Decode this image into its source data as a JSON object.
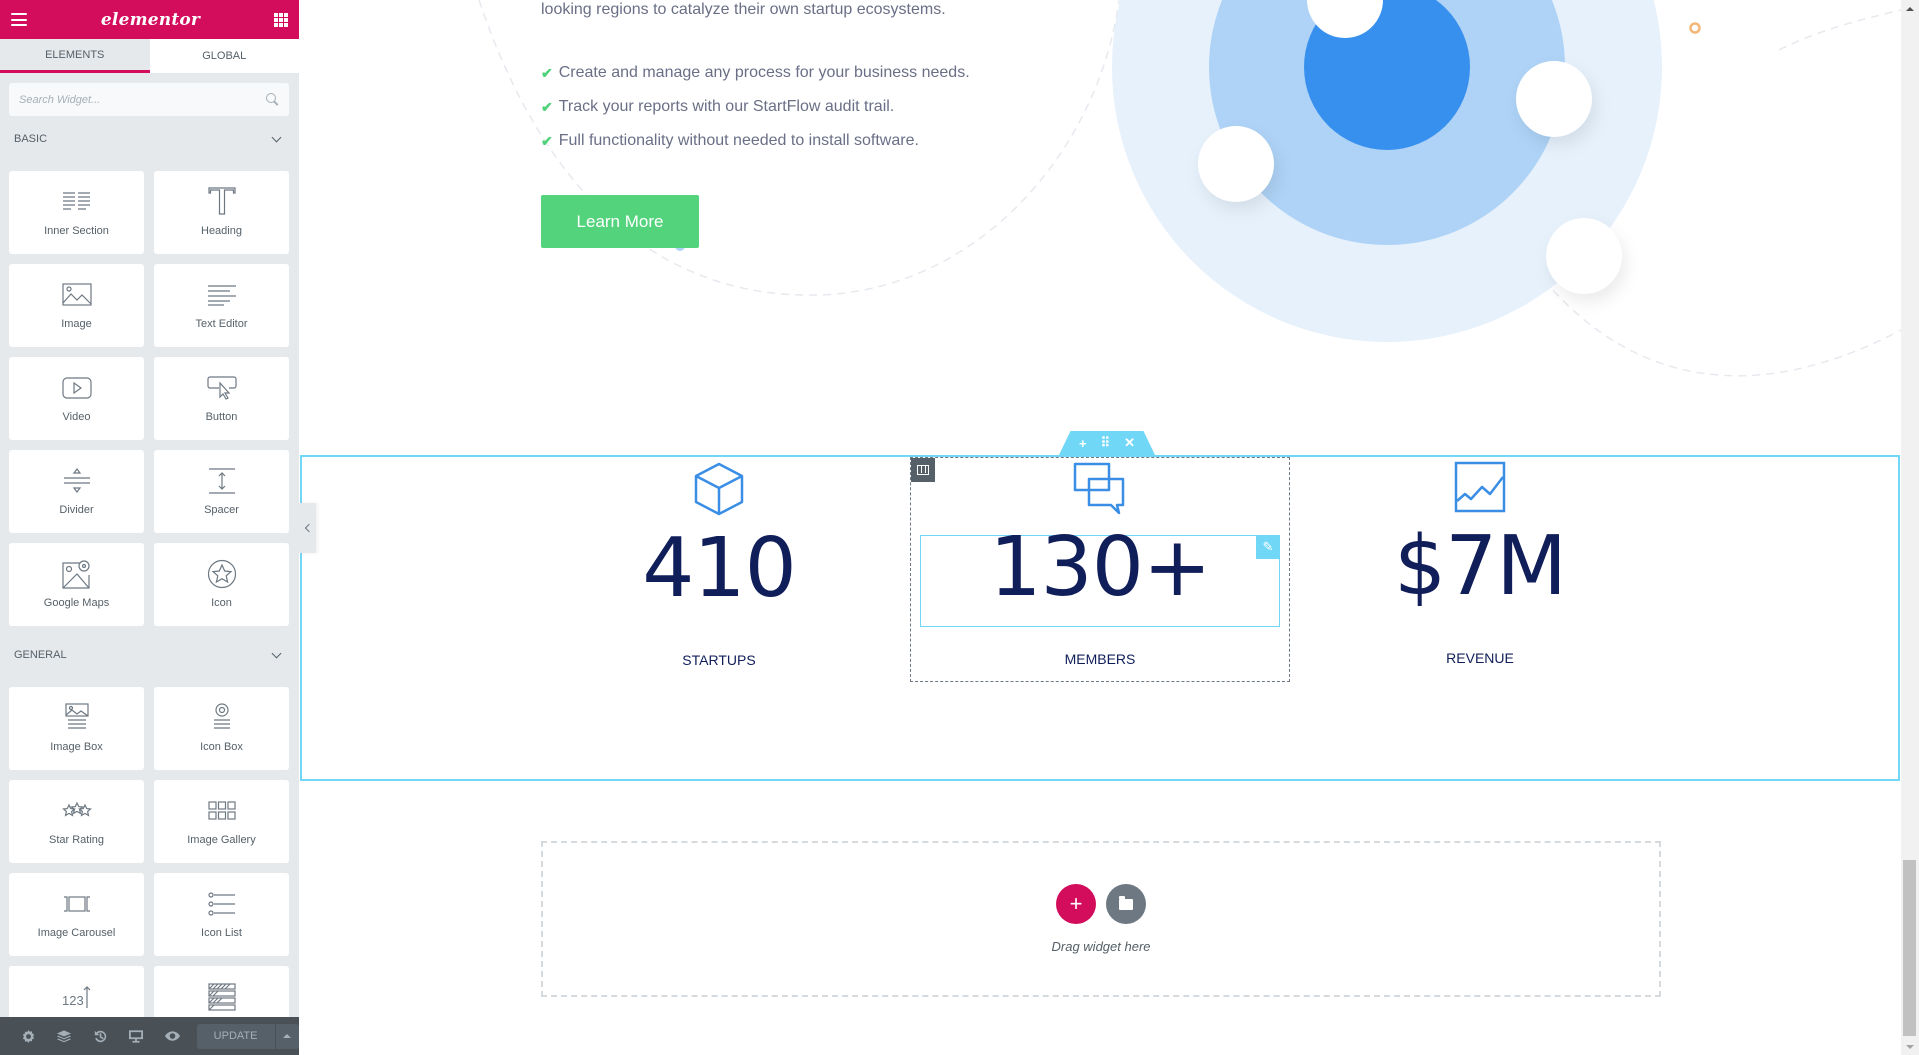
{
  "editor": {
    "brand": "elementor",
    "brand_color": "#d30c5c",
    "tabs": [
      {
        "label": "ELEMENTS",
        "active": true
      },
      {
        "label": "GLOBAL",
        "active": false
      }
    ],
    "search": {
      "placeholder": "Search Widget...",
      "value": ""
    },
    "categories": [
      {
        "title": "BASIC",
        "widgets": [
          {
            "label": "Inner Section",
            "icon": "inner-section-icon"
          },
          {
            "label": "Heading",
            "icon": "heading-icon"
          },
          {
            "label": "Image",
            "icon": "image-icon"
          },
          {
            "label": "Text Editor",
            "icon": "text-editor-icon"
          },
          {
            "label": "Video",
            "icon": "video-icon"
          },
          {
            "label": "Button",
            "icon": "button-icon"
          },
          {
            "label": "Divider",
            "icon": "divider-icon"
          },
          {
            "label": "Spacer",
            "icon": "spacer-icon"
          },
          {
            "label": "Google Maps",
            "icon": "google-maps-icon"
          },
          {
            "label": "Icon",
            "icon": "star-icon"
          }
        ]
      },
      {
        "title": "GENERAL",
        "widgets": [
          {
            "label": "Image Box",
            "icon": "image-box-icon"
          },
          {
            "label": "Icon Box",
            "icon": "icon-box-icon"
          },
          {
            "label": "Star Rating",
            "icon": "star-rating-icon"
          },
          {
            "label": "Image Gallery",
            "icon": "image-gallery-icon"
          },
          {
            "label": "Image Carousel",
            "icon": "image-carousel-icon"
          },
          {
            "label": "Icon List",
            "icon": "icon-list-icon"
          },
          {
            "label": "",
            "icon": "counter-icon"
          },
          {
            "label": "",
            "icon": "progress-bar-icon"
          }
        ]
      }
    ],
    "footer": {
      "icons": [
        "settings-icon",
        "navigator-icon",
        "history-icon",
        "responsive-mode-icon",
        "preview-icon"
      ],
      "update_label": "UPDATE"
    }
  },
  "page": {
    "intro_text": "looking regions to catalyze their own startup ecosystems.",
    "checklist": [
      "Create and manage any process for your business needs.",
      "Track your reports with our StartFlow audit trail.",
      "Full functionality without needed to install software."
    ],
    "cta_label": "Learn More",
    "cta_color": "#53d37b",
    "section_handle": {
      "add": "+",
      "move": "⠿",
      "close": "✕"
    },
    "counters": [
      {
        "number": "410",
        "label": "STARTUPS",
        "icon": "cube-icon"
      },
      {
        "number": "130+",
        "label": "MEMBERS",
        "icon": "chat-bubbles-icon"
      },
      {
        "number": "$7M",
        "label": "REVENUE",
        "icon": "line-chart-icon"
      }
    ],
    "counter_color": "#101e59",
    "icon_color": "#3a8ee6",
    "dropzone": {
      "add_symbol": "+",
      "text": "Drag widget here"
    }
  }
}
